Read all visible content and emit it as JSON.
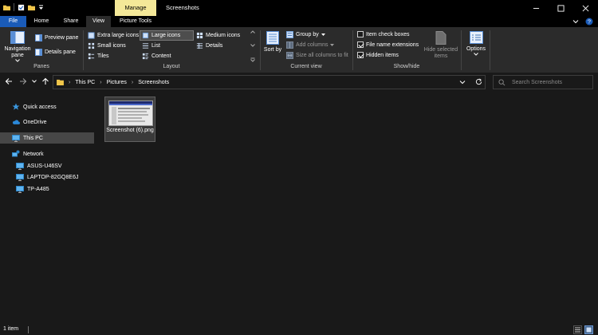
{
  "title_bar": {
    "manage_tab": "Manage",
    "window_title": "Screenshots"
  },
  "ribbon_tabs": {
    "file": "File",
    "home": "Home",
    "share": "Share",
    "view": "View",
    "picture_tools": "Picture Tools"
  },
  "panes": {
    "navigation_pane": "Navigation pane",
    "preview_pane": "Preview pane",
    "details_pane": "Details pane",
    "group_label": "Panes"
  },
  "layout": {
    "extra_large_icons": "Extra large icons",
    "large_icons": "Large icons",
    "medium_icons": "Medium icons",
    "small_icons": "Small icons",
    "list": "List",
    "details": "Details",
    "tiles": "Tiles",
    "content": "Content",
    "selected": "Large icons",
    "group_label": "Layout"
  },
  "current_view": {
    "sort_by": "Sort by",
    "group_by": "Group by",
    "add_columns": "Add columns",
    "size_all_columns": "Size all columns to fit",
    "group_label": "Current view"
  },
  "show_hide": {
    "item_check_boxes": "Item check boxes",
    "item_check_boxes_checked": false,
    "file_name_extensions": "File name extensions",
    "file_name_extensions_checked": true,
    "hidden_items": "Hidden items",
    "hidden_items_checked": true,
    "hide_selected_items": "Hide selected items",
    "group_label": "Show/hide"
  },
  "options": {
    "label": "Options"
  },
  "address": {
    "crumbs": [
      "This PC",
      "Pictures",
      "Screenshots"
    ]
  },
  "search": {
    "placeholder": "Search Screenshots"
  },
  "nav_pane": {
    "quick_access": "Quick access",
    "onedrive": "OneDrive",
    "this_pc": "This PC",
    "network": "Network",
    "network_items": [
      "ASUS-U46SV",
      "LAPTOP-82GQ8E6J",
      "TP-A485"
    ]
  },
  "files": [
    {
      "name": "Screenshot (6).png"
    }
  ],
  "status": {
    "item_count": "1 item"
  },
  "colors": {
    "file_tab": "#1a5bb8",
    "manage_tab": "#f4e898",
    "background": "#191919",
    "ribbon": "#2b2b2b"
  }
}
